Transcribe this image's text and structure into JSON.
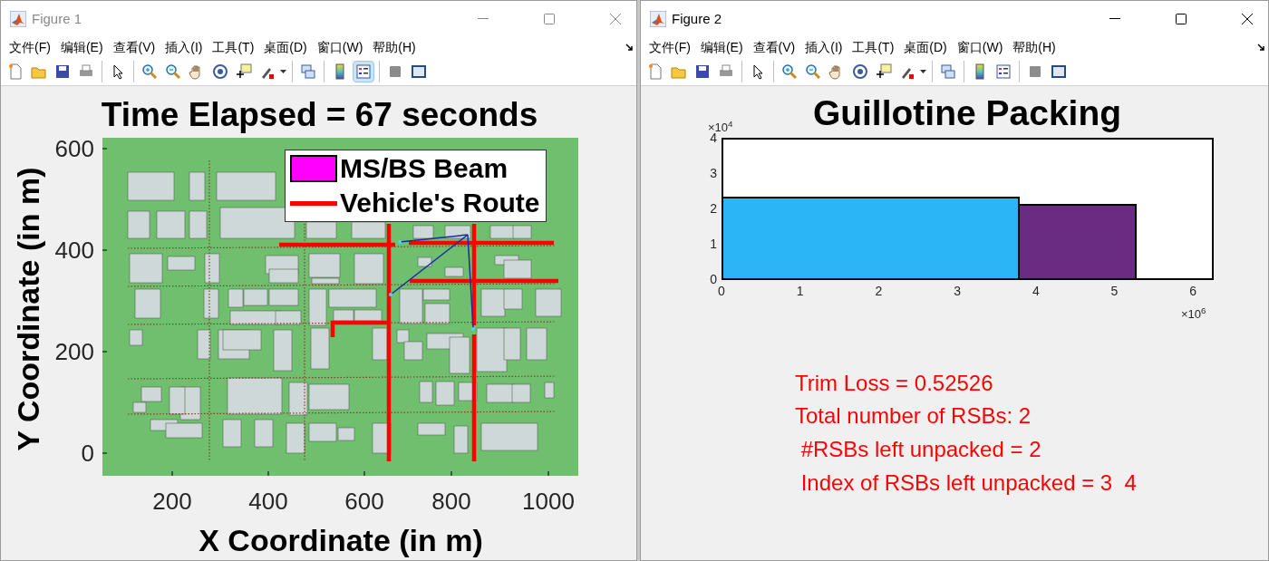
{
  "windows": [
    {
      "title": "Figure 1",
      "active": false,
      "menu": [
        "文件(F)",
        "编辑(E)",
        "查看(V)",
        "插入(I)",
        "工具(T)",
        "桌面(D)",
        "窗口(W)",
        "帮助(H)"
      ],
      "legend_tool_selected": true,
      "plot": {
        "title": "Time Elapsed = 67 seconds",
        "xlabel": "X Coordinate (in m)",
        "ylabel": "Y Coordinate (in m)",
        "xticks": [
          "200",
          "400",
          "600",
          "800",
          "1000"
        ],
        "yticks": [
          "600",
          "400",
          "200",
          "0"
        ],
        "legend": [
          {
            "kind": "patch",
            "label": "MS/BS Beam",
            "color": "#ff00ff"
          },
          {
            "kind": "line",
            "label": "Vehicle's Route",
            "color": "#ff0000"
          }
        ]
      }
    },
    {
      "title": "Figure 2",
      "active": true,
      "menu": [
        "文件(F)",
        "编辑(E)",
        "查看(V)",
        "插入(I)",
        "工具(T)",
        "桌面(D)",
        "窗口(W)",
        "帮助(H)"
      ],
      "legend_tool_selected": false,
      "plot": {
        "title": "Guillotine Packing",
        "yexponent": "×10$^{4}$",
        "xexponent": "×10$^{6}$",
        "yticks": [
          "4",
          "3",
          "2",
          "1",
          "0"
        ],
        "xticks": [
          "0",
          "1",
          "2",
          "3",
          "4",
          "5",
          "6"
        ],
        "packed_items": [
          {
            "color": "#2bb5f7"
          },
          {
            "color": "#6a2b82"
          }
        ],
        "notes": [
          "Trim Loss = 0.52526",
          "Total number of RSBs: 2",
          " #RSBs left unpacked = 2",
          " Index of RSBs left unpacked = 3  4"
        ]
      }
    }
  ]
}
